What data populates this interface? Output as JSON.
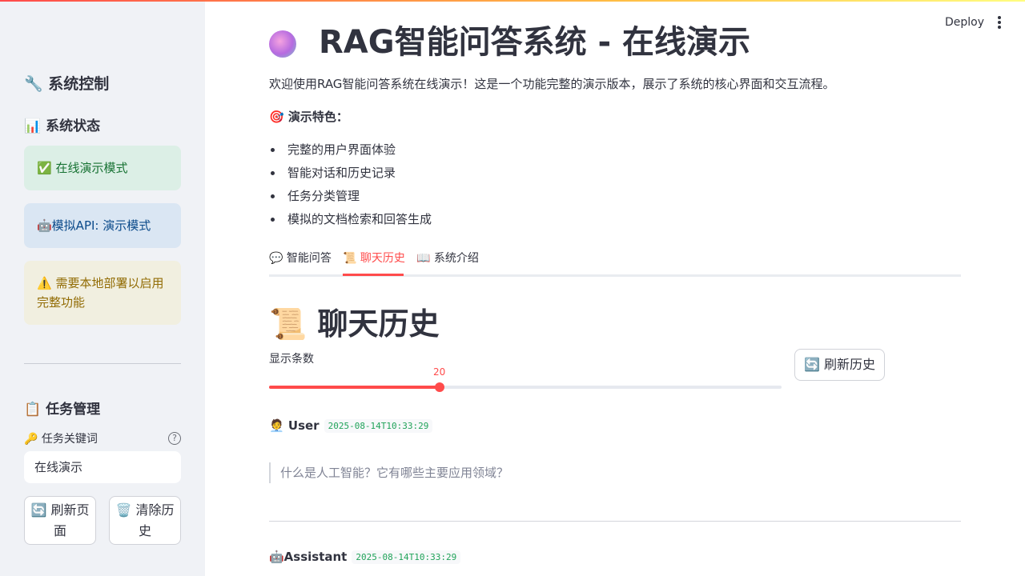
{
  "header": {
    "deploy_label": "Deploy",
    "menu_icon": "more-vertical-icon"
  },
  "sidebar": {
    "title": "🔧 系统控制",
    "status_heading": "📊 系统状态",
    "alerts": {
      "success": "✅ 在线演示模式",
      "info": "🤖模拟API: 演示模式",
      "warning": "⚠️ 需要本地部署以启用完整功能"
    },
    "task_heading": "📋 任务管理",
    "task_keyword_label": "🔑 任务关键词",
    "task_keyword_value": "在线演示",
    "refresh_button": "🔄 刷新页面",
    "clear_button": "🗑️ 清除历史"
  },
  "main": {
    "title": "RAG智能问答系统 - 在线演示",
    "intro": "欢迎使用RAG智能问答系统在线演示！这是一个功能完整的演示版本，展示了系统的核心界面和交互流程。",
    "features_heading": "🎯 演示特色：",
    "features": [
      "完整的用户界面体验",
      "智能对话和历史记录",
      "任务分类管理",
      "模拟的文档检索和回答生成"
    ],
    "tabs": [
      {
        "label": "💬 智能问答"
      },
      {
        "label": "📜 聊天历史"
      },
      {
        "label": "📖 系统介绍"
      }
    ],
    "active_tab": 1
  },
  "history": {
    "heading": "📜 聊天历史",
    "slider_label": "显示条数",
    "slider_value": "20",
    "slider_fraction": 0.333,
    "refresh_button": "🔄 刷新历史",
    "messages": [
      {
        "role": "🧑‍💼 User",
        "timestamp": "2025-08-14T10:33:29",
        "content": "什么是人工智能？它有哪些主要应用领域？"
      },
      {
        "role": "🤖Assistant",
        "timestamp": "2025-08-14T10:33:29"
      }
    ]
  },
  "colors": {
    "accent": "#ff4b4b",
    "sidebar_bg": "#f0f2f6",
    "success_bg": "#dcefe6",
    "info_bg": "#dae6f3",
    "warning_bg": "#f1efe0"
  }
}
